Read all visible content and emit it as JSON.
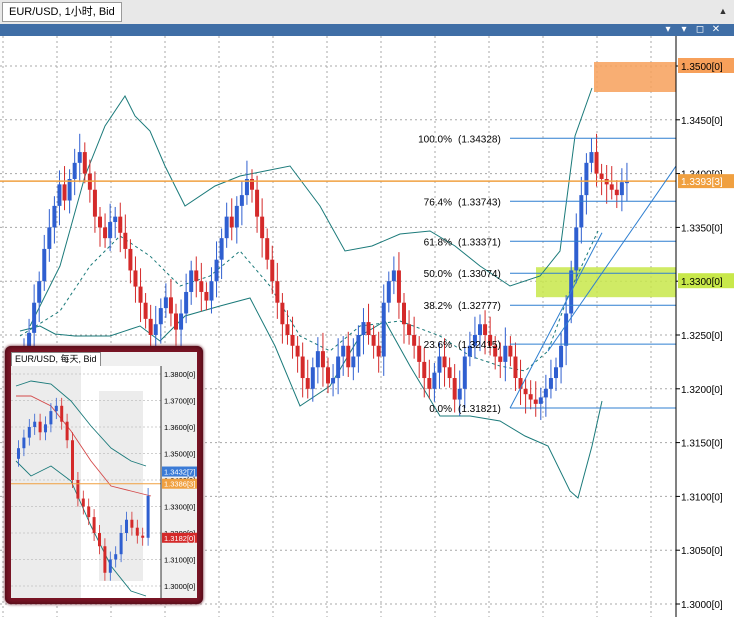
{
  "window": {
    "tab_title": "EUR/USD, 1小时, Bid",
    "scroll_glyph": "▲",
    "buttons": [
      "▾",
      "▾",
      "◻",
      "✕"
    ]
  },
  "chart_data": {
    "type": "candlestick",
    "y_axis_labels": [
      "1.3500[0]",
      "1.3450[0]",
      "1.3400[0]",
      "1.3350[0]",
      "1.3300[0]",
      "1.3250[0]",
      "1.3200[0]",
      "1.3150[0]",
      "1.3100[0]",
      "1.3050[0]",
      "1.3000[0]"
    ],
    "y_axis_values": [
      1.35,
      1.345,
      1.34,
      1.335,
      1.33,
      1.325,
      1.32,
      1.315,
      1.31,
      1.305,
      1.3
    ],
    "current_price_label": "1.3393[3]",
    "current_price": 1.3393,
    "fibonacci_levels": [
      {
        "label": "100.0%",
        "price_label": "(1.34328)",
        "price": 1.34328
      },
      {
        "label": "76.4%",
        "price_label": "(1.33743)",
        "price": 1.33743
      },
      {
        "label": "61.8%",
        "price_label": "(1.33371)",
        "price": 1.33371
      },
      {
        "label": "50.0%",
        "price_label": "(1.33074)",
        "price": 1.33074
      },
      {
        "label": "38.2%",
        "price_label": "(1.32777)",
        "price": 1.32777
      },
      {
        "label": "23.6%",
        "price_label": "(1.32415)",
        "price": 1.32415
      },
      {
        "label": "0.0%",
        "price_label": "(1.31821)",
        "price": 1.31821
      }
    ],
    "highlight_zones": [
      {
        "label": "1.3500[0]",
        "price": 1.35,
        "color": "#f7a05a"
      },
      {
        "label": "1.3300[0]",
        "price": 1.33,
        "color": "#c8e84a"
      }
    ],
    "colors": {
      "bull": "#2f5fd0",
      "bear": "#d42a2a",
      "band": "#1b7a7a",
      "fib": "#2f7fd0",
      "price_line": "#f0a040",
      "grid": "#a8a8a8",
      "axis": "#000000"
    }
  },
  "inset": {
    "title": "EUR/USD, 每天, Bid",
    "y_axis_labels": [
      "1.3800[0]",
      "1.3700[0]",
      "1.3600[0]",
      "1.3500[0]",
      "1.3400[0]",
      "1.3300[0]",
      "1.3200[0]",
      "1.3100[0]",
      "1.3000[0]"
    ],
    "y_axis_values": [
      1.38,
      1.37,
      1.36,
      1.35,
      1.34,
      1.33,
      1.32,
      1.31,
      1.3
    ],
    "tags": [
      {
        "label": "1.3432[7]",
        "price": 1.3432,
        "color": "#3b7bd6"
      },
      {
        "label": "1.3386[3]",
        "price": 1.3386,
        "color": "#f0a040"
      },
      {
        "label": "1.3182[0]",
        "price": 1.3182,
        "color": "#d42a2a"
      }
    ]
  }
}
